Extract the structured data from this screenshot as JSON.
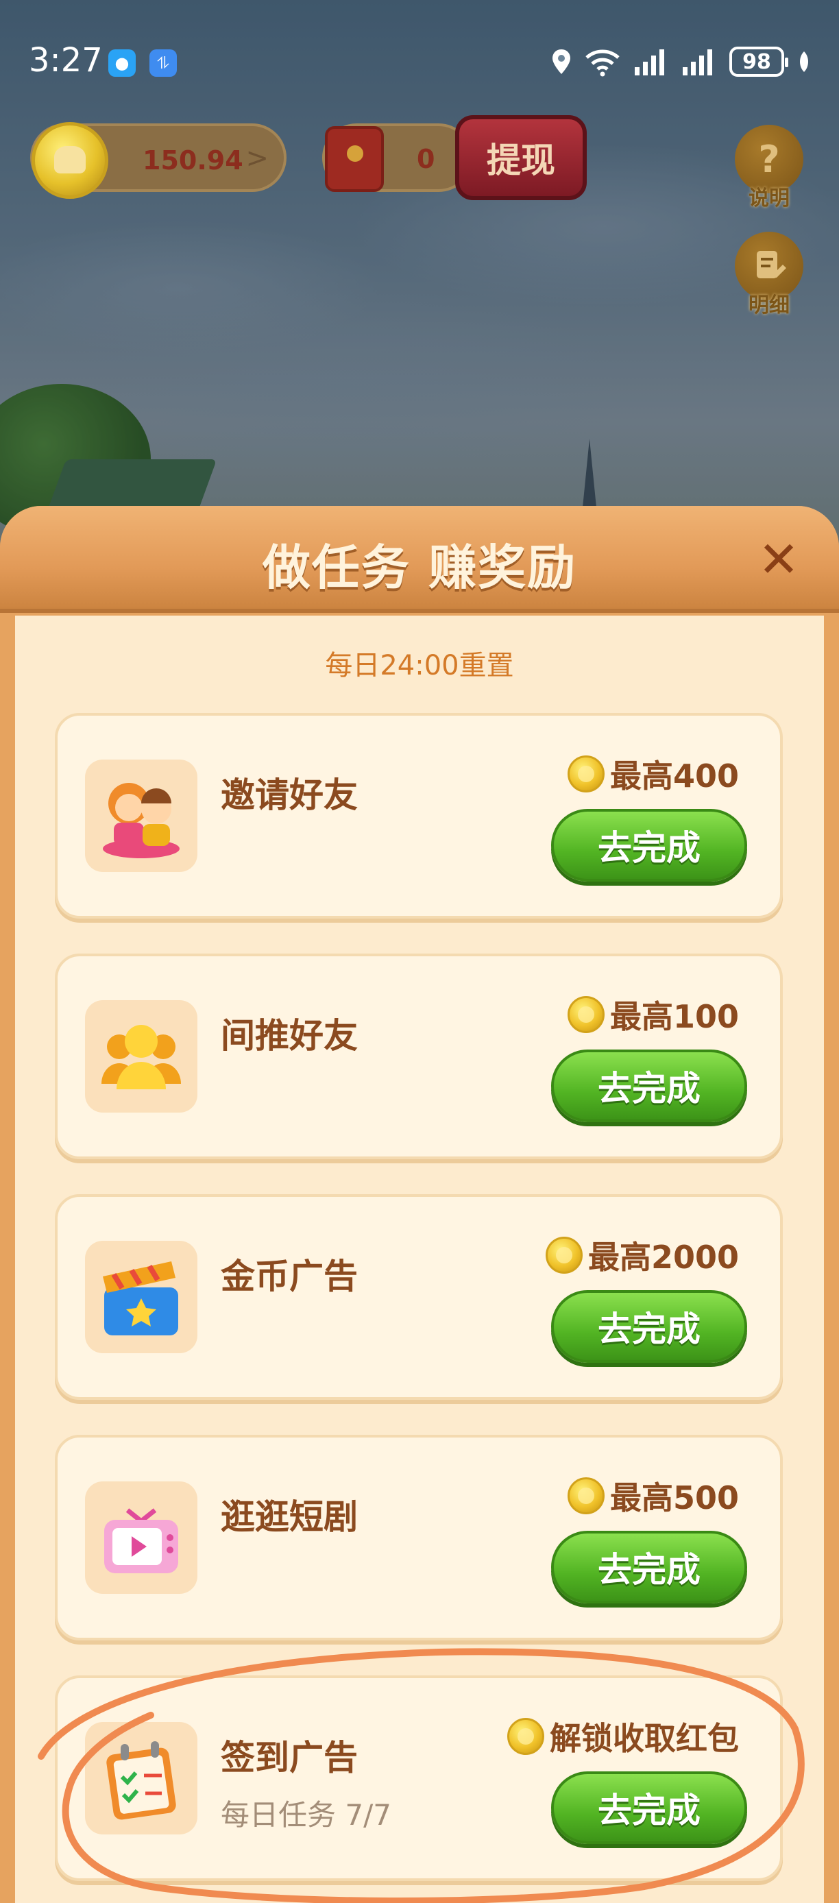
{
  "status_bar": {
    "time": "3:27",
    "battery": "98",
    "icons": [
      "message-app-icon",
      "app-icon",
      "location-icon",
      "wifi-icon",
      "signal-icon",
      "signal-icon",
      "battery-icon",
      "leaf-icon"
    ]
  },
  "hud": {
    "coin_balance": "150.94",
    "coin_arrow": ">",
    "red_packet_count": "0",
    "withdraw_label": "提现",
    "help_label": "说明",
    "help_glyph": "?",
    "detail_label": "明细"
  },
  "panel": {
    "title": "做任务 赚奖励",
    "close_glyph": "✕",
    "reset_note": "每日24:00重置"
  },
  "tasks": [
    {
      "name": "邀请好友",
      "reward": "最高400",
      "button": "去完成",
      "icon": "invite-friends-icon"
    },
    {
      "name": "间推好友",
      "reward": "最高100",
      "button": "去完成",
      "icon": "group-users-icon"
    },
    {
      "name": "金币广告",
      "reward": "最高2000",
      "button": "去完成",
      "icon": "clapperboard-icon"
    },
    {
      "name": "逛逛短剧",
      "reward": "最高500",
      "button": "去完成",
      "icon": "tv-play-icon"
    },
    {
      "name": "签到广告",
      "sub": "每日任务 7/7",
      "reward": "解锁收取红包",
      "button": "去完成",
      "icon": "checklist-icon"
    }
  ],
  "colors": {
    "panel": "#e6a35f",
    "card": "#fff5e2",
    "button_green": "#52b423",
    "text_brown": "#8b4a1f",
    "annotation": "#f08a50"
  }
}
